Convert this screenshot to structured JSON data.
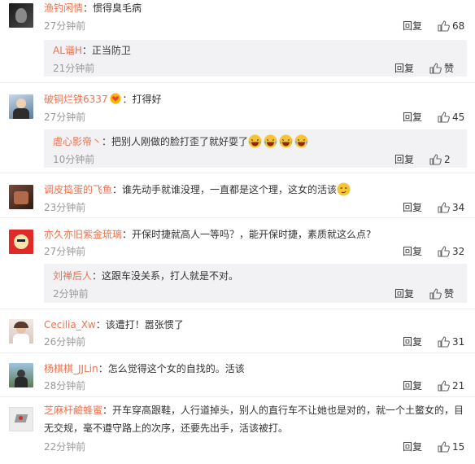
{
  "comments": [
    {
      "user": "渔钓闲情",
      "text": "：惯得臭毛病",
      "time": "27分钟前",
      "reply_label": "回复",
      "likes": "68",
      "sub_reply": {
        "user": "AL谐H",
        "text": "：正当防卫",
        "time": "21分钟前",
        "reply_label": "回复",
        "like_label": "赞"
      }
    },
    {
      "user": "破铜烂铁6337",
      "text": "：打得好",
      "time": "27分钟前",
      "reply_label": "回复",
      "likes": "45",
      "sub_reply": {
        "user": "虐心影帝丶",
        "text": "：把别人刚做的脸打歪了就好耍了",
        "time": "10分钟前",
        "reply_label": "回复",
        "likes": "2"
      }
    },
    {
      "user": "调皮捣蛋的飞鱼",
      "text": "：谁先动手就谁没理，一直都是这个理，这女的活该",
      "time": "23分钟前",
      "reply_label": "回复",
      "likes": "34"
    },
    {
      "user": "亦久亦旧紫金琉璃",
      "text": "：开保时捷就高人一等吗？，能开保时捷，素质就这么点?",
      "time": "27分钟前",
      "reply_label": "回复",
      "likes": "32",
      "sub_reply": {
        "user": "刘禅后人",
        "text": "：这跟车没关系，打人就是不对。",
        "time": "2分钟前",
        "reply_label": "回复",
        "like_label": "赞"
      }
    },
    {
      "user": "Cecilia_Xw",
      "text": "：该遭打！嚣张惯了",
      "time": "26分钟前",
      "reply_label": "回复",
      "likes": "31"
    },
    {
      "user": "杨棋棋_JJLin",
      "text": "：怎么觉得这个女的自找的。活该",
      "time": "28分钟前",
      "reply_label": "回复",
      "likes": "21"
    },
    {
      "user": "芝麻杆鹼蜂蜜",
      "text": "：开车穿高跟鞋，人行道掉头，别人的直行车不让她也是对的，就一个土鳖女的，目无交规，毫不遵守路上的次序，还要先出手，活该被打。",
      "time": "22分钟前",
      "reply_label": "回复",
      "likes": "15"
    }
  ],
  "icons": {
    "like": "thumbs-up-icon",
    "vip": "vip-heart-badge-icon",
    "emoji": "laughing-tears-emoji-icon"
  },
  "colors": {
    "username": "#eb7350",
    "meta": "#999999",
    "sub_bg": "#f2f2f5",
    "divider": "#eeeeee"
  }
}
